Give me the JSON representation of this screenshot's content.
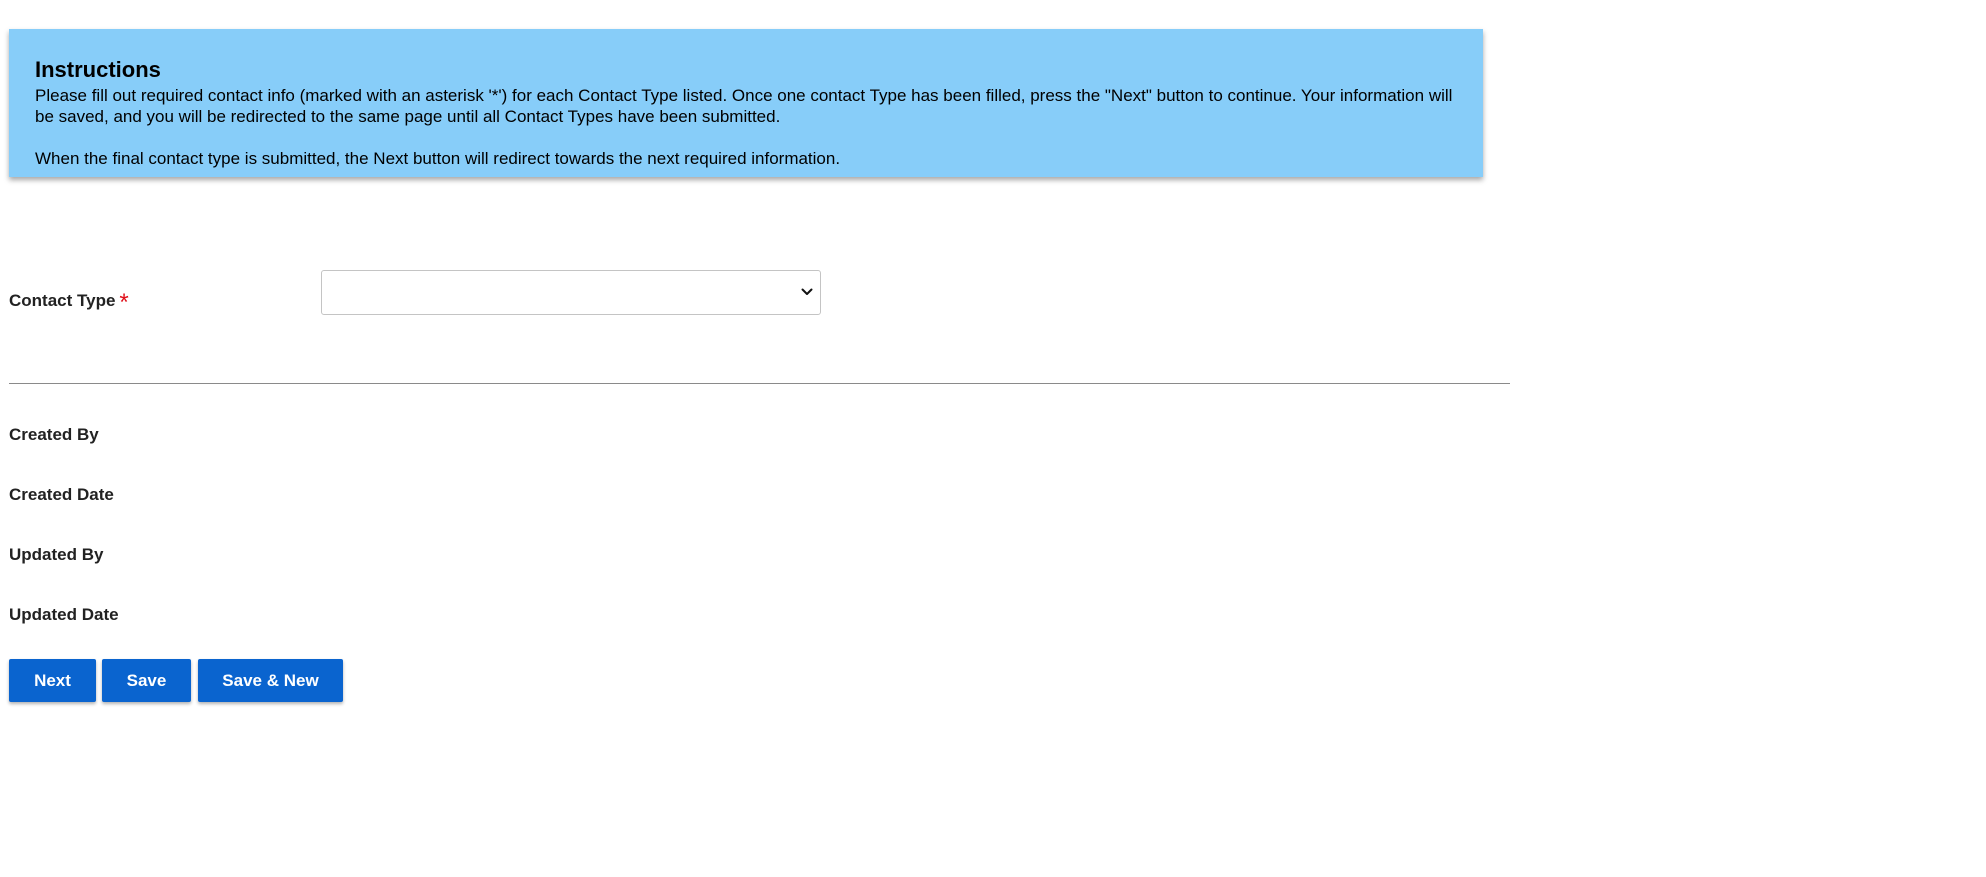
{
  "instructions": {
    "title": "Instructions",
    "line1": "Please fill out required contact info (marked with an asterisk '*') for each Contact Type listed. Once one contact Type has been filled, press the \"Next\" button to continue. Your information will be saved, and you will be redirected to the same page until all Contact Types have been submitted.",
    "line2": "When the final contact type is submitted, the Next button will redirect towards the next required information."
  },
  "form": {
    "contact_type_label": "Contact Type",
    "required_marker": "*",
    "contact_type_value": ""
  },
  "audit": {
    "created_by": "Created By",
    "created_date": "Created Date",
    "updated_by": "Updated By",
    "updated_date": "Updated Date"
  },
  "buttons": {
    "next": "Next",
    "save": "Save",
    "save_new": "Save & New"
  },
  "colors": {
    "instructions_bg": "#87cdf9",
    "button_bg": "#0a64cf",
    "required": "#e0101a"
  },
  "icons": {
    "select_chevron": "chevron-down-icon"
  }
}
